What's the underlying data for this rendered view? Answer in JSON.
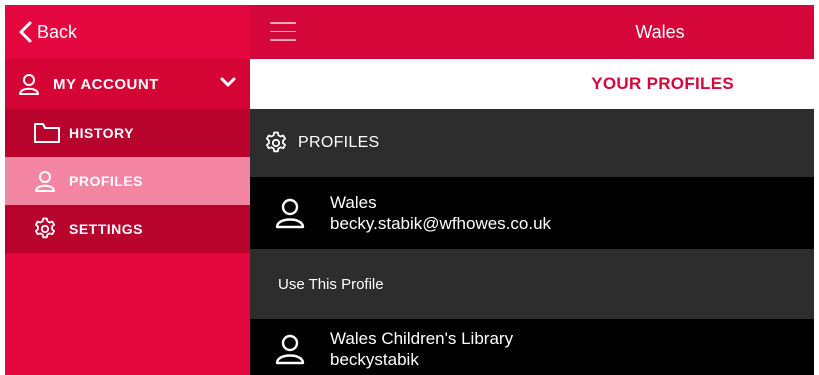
{
  "sidebar": {
    "back_label": "Back",
    "account_label": "MY ACCOUNT",
    "items": [
      {
        "label": "HISTORY",
        "icon": "folder-icon"
      },
      {
        "label": "PROFILES",
        "icon": "user-icon"
      },
      {
        "label": "SETTINGS",
        "icon": "gear-icon"
      }
    ]
  },
  "header": {
    "title": "Wales"
  },
  "main": {
    "subheader_title": "YOUR PROFILES",
    "section_label": "PROFILES",
    "profiles": [
      {
        "name": "Wales",
        "detail": "becky.stabik@wfhowes.co.uk"
      },
      {
        "name": "Wales Children's Library",
        "detail": "beckystabik"
      }
    ],
    "use_profile_label": "Use This Profile"
  },
  "colors": {
    "brand_red": "#e4073f",
    "topbar_red": "#d4063a",
    "sidebar_active": "#f486a3",
    "sidebar_sub": "#b8032c",
    "dark_row": "#2d2d2d"
  }
}
